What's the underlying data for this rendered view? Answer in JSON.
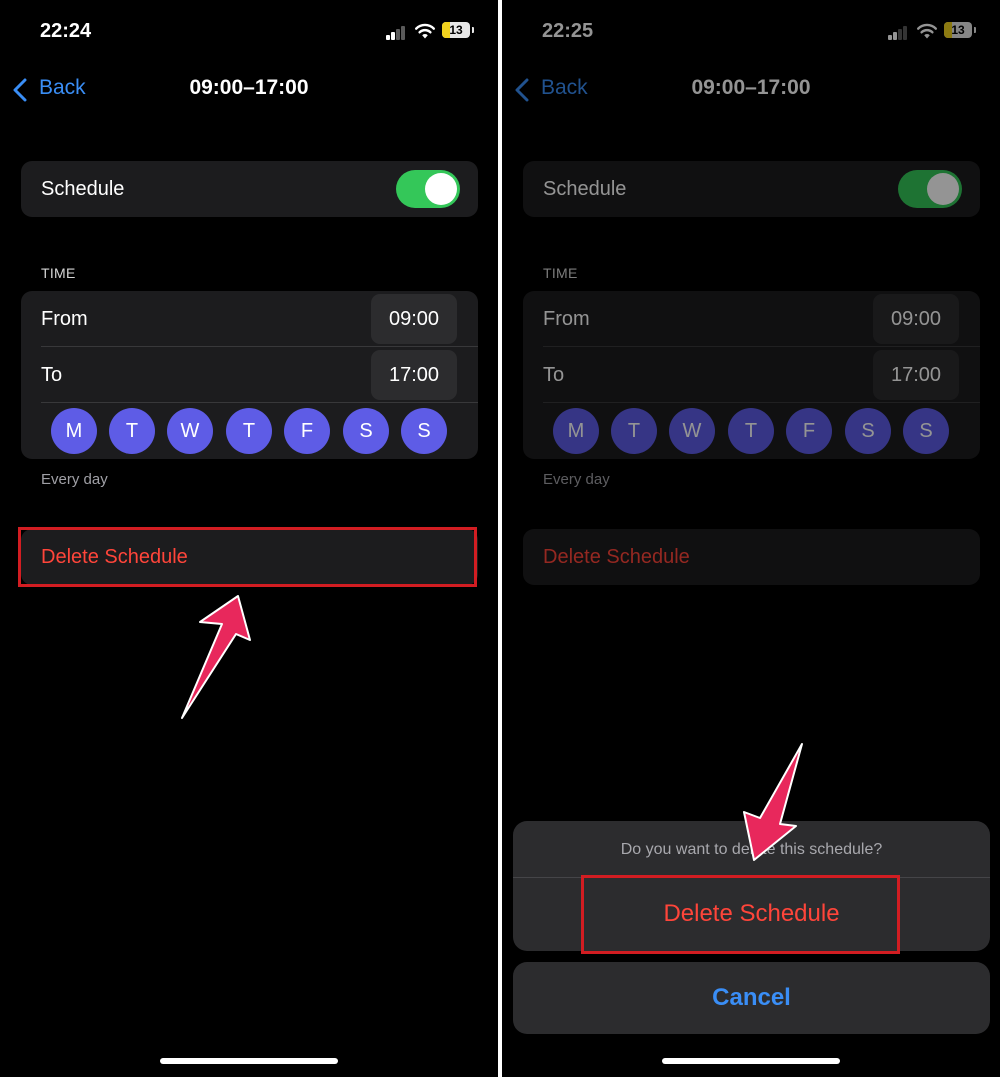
{
  "left": {
    "status": {
      "time": "22:24",
      "battery": "13"
    },
    "nav": {
      "back_label": "Back",
      "title": "09:00–17:00"
    },
    "schedule": {
      "label": "Schedule",
      "enabled": true
    },
    "time_section": {
      "header": "TIME",
      "from_label": "From",
      "from_value": "09:00",
      "to_label": "To",
      "to_value": "17:00"
    },
    "days": [
      "M",
      "T",
      "W",
      "T",
      "F",
      "S",
      "S"
    ],
    "footnote": "Every day",
    "delete_label": "Delete Schedule"
  },
  "right": {
    "status": {
      "time": "22:25",
      "battery": "13"
    },
    "nav": {
      "back_label": "Back",
      "title": "09:00–17:00"
    },
    "schedule": {
      "label": "Schedule",
      "enabled": true
    },
    "time_section": {
      "header": "TIME",
      "from_label": "From",
      "from_value": "09:00",
      "to_label": "To",
      "to_value": "17:00"
    },
    "days": [
      "M",
      "T",
      "W",
      "T",
      "F",
      "S",
      "S"
    ],
    "footnote": "Every day",
    "delete_label": "Delete Schedule",
    "action_sheet": {
      "message": "Do you want to delete this schedule?",
      "delete_button": "Delete Schedule",
      "cancel_button": "Cancel"
    }
  },
  "colors": {
    "accent": "#3a8ef6",
    "toggle_on": "#34c759",
    "destructive": "#ff453a",
    "day_fill": "#5e5ce6",
    "highlight": "#d21d22",
    "arrow": "#e8285c"
  }
}
